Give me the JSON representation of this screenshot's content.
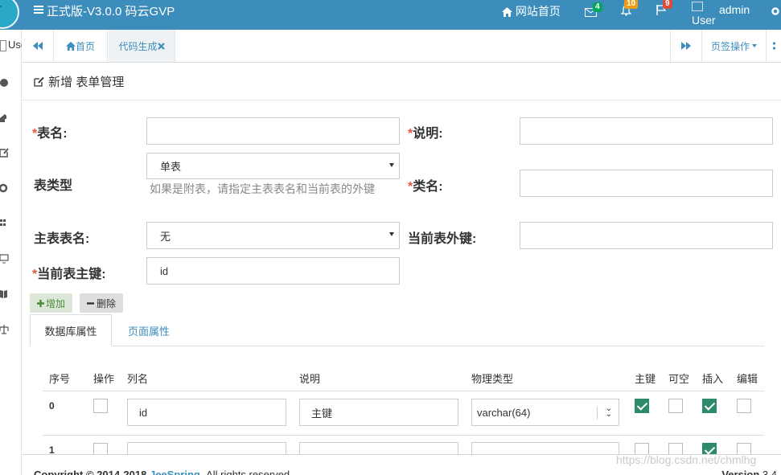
{
  "navbar": {
    "title": "正式版-V3.0.0 码云GVP",
    "website_home": "网站首页",
    "mail_badge": "4",
    "bell_badge": "10",
    "flag_badge": "9",
    "avatar_alt": "User",
    "username": "admin"
  },
  "sidebar_user_stub": "Use",
  "tabbar": {
    "home_tab": "首页",
    "current_tab": "代码生成",
    "tab_ops": "页签操作"
  },
  "page": {
    "heading": "新增 表单管理"
  },
  "form": {
    "table_name_label": "表名:",
    "comment_label": "说明:",
    "table_type_label": "表类型",
    "table_type_value": "单表",
    "table_type_help": "如果是附表，请指定主表表名和当前表的外键",
    "class_name_label": "类名:",
    "parent_table_label": "主表表名:",
    "parent_table_value": "无",
    "parent_fk_label": "当前表外键:",
    "pk_label": "当前表主键:",
    "pk_value": "id",
    "required_mark": "*"
  },
  "buttons": {
    "add": "增加",
    "delete": "删除"
  },
  "inner_tabs": {
    "db_props": "数据库属性",
    "page_props": "页面属性"
  },
  "table": {
    "headers": {
      "seq": "序号",
      "op": "操作",
      "column": "列名",
      "comment": "说明",
      "jdbc_type": "物理类型",
      "pk": "主键",
      "nullable": "可空",
      "insert": "插入",
      "edit": "编辑"
    },
    "rows": [
      {
        "seq": "0",
        "column": "id",
        "comment": "主键",
        "jdbc_type": "varchar(64)",
        "op": false,
        "pk": true,
        "nullable": false,
        "insert": true,
        "edit": false
      },
      {
        "seq": "1",
        "column": "",
        "comment": "",
        "jdbc_type": "",
        "op": false,
        "pk": false,
        "nullable": false,
        "insert": true,
        "edit": false
      }
    ]
  },
  "footer": {
    "copyright_prefix": "Copyright © 2014-2018",
    "brand": "JeeSpring.",
    "rights": "All rights reserved.",
    "version_label": "Version",
    "version_value": "3.4"
  },
  "watermark": "https://blog.csdn.net/chmlhg",
  "colors": {
    "navbar": "#3c8dbc",
    "link": "#3c8dbc",
    "required": "#e3563e",
    "checked": "#2e8b69",
    "badge_green": "#00a65a",
    "badge_orange": "#f39c12",
    "badge_red": "#dd4b39"
  }
}
